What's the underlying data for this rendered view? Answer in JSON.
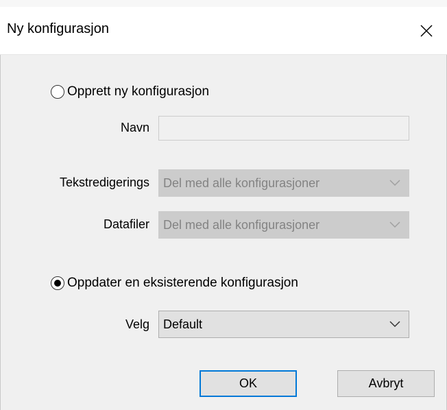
{
  "window": {
    "title": "Ny konfigurasjon"
  },
  "create": {
    "radio_label": "Opprett ny konfigurasjon",
    "checked": false,
    "name_label": "Navn",
    "name_value": ""
  },
  "text_editing": {
    "label": "Tekstredigerings",
    "value": "Del med alle konfigurasjoner"
  },
  "data_files": {
    "label": "Datafiler",
    "value": "Del med alle konfigurasjoner"
  },
  "update": {
    "radio_label": "Oppdater en eksisterende konfigurasjon",
    "checked": true,
    "select_label": "Velg",
    "select_value": "Default"
  },
  "buttons": {
    "ok": "OK",
    "cancel": "Avbryt"
  },
  "colors": {
    "accent": "#0078d7",
    "disabled_fill": "#cccccc",
    "disabled_text": "#838383"
  }
}
